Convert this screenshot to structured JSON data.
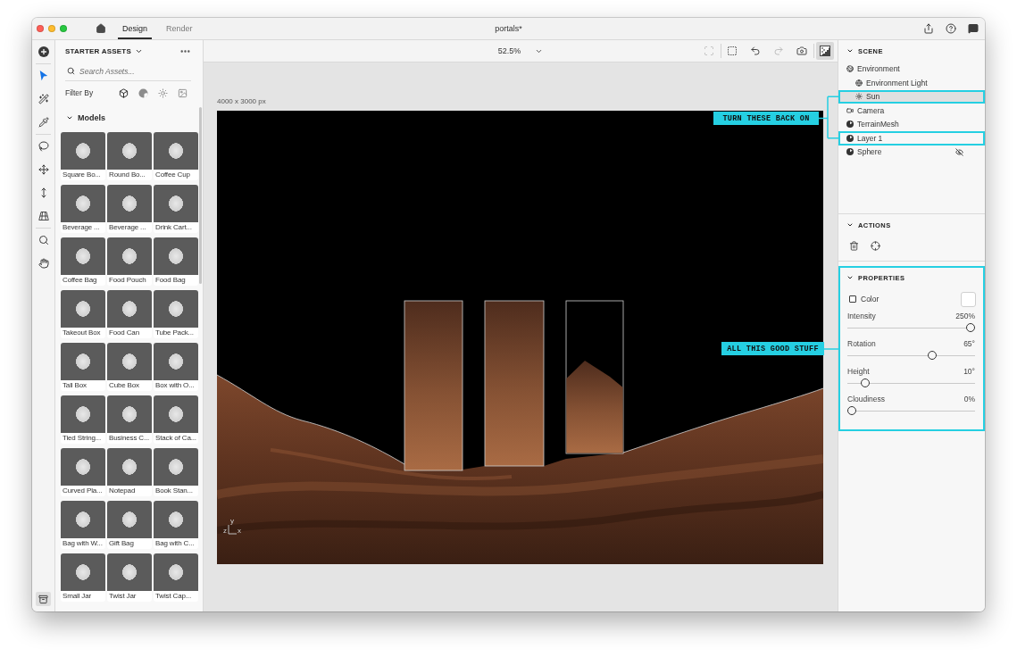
{
  "window": {
    "title": "portals*",
    "tabs": [
      {
        "label": "Design",
        "selected": true
      },
      {
        "label": "Render",
        "selected": false
      }
    ]
  },
  "toolbar": {
    "groups": [
      [
        {
          "kind": "add",
          "selected": false
        }
      ],
      [
        {
          "kind": "select",
          "selected": true
        },
        {
          "kind": "wand",
          "selected": false
        },
        {
          "kind": "eyedropper",
          "selected": false
        }
      ],
      [
        {
          "kind": "lasso",
          "selected": false
        },
        {
          "kind": "move",
          "selected": false
        },
        {
          "kind": "resize",
          "selected": false
        },
        {
          "kind": "perspective",
          "selected": false
        }
      ],
      [
        {
          "kind": "zoom",
          "selected": false
        },
        {
          "kind": "hand",
          "selected": false
        }
      ]
    ]
  },
  "assets": {
    "title": "STARTER ASSETS",
    "search": {
      "placeholder": "Search Assets..."
    },
    "filter_label": "Filter By",
    "filters": [
      {
        "kind": "model",
        "selected": true
      },
      {
        "kind": "material",
        "selected": false
      },
      {
        "kind": "light",
        "selected": false
      },
      {
        "kind": "image",
        "selected": false
      }
    ],
    "section": {
      "title": "Models",
      "expanded": true,
      "items": [
        "Square Bo...",
        "Round Bo...",
        "Coffee Cup",
        "Beverage ...",
        "Beverage ...",
        "Drink Cart...",
        "Coffee Bag",
        "Food Pouch",
        "Food Bag",
        "Takeout Box",
        "Food Can",
        "Tube Pack...",
        "Tall Box",
        "Cube Box",
        "Box with O...",
        "Tied String...",
        "Business C...",
        "Stack of Ca...",
        "Curved Pla...",
        "Notepad",
        "Book Stan...",
        "Bag with W...",
        "Gift Bag",
        "Bag with C...",
        "Small Jar",
        "Twist Jar",
        "Twist Cap..."
      ]
    }
  },
  "canvas": {
    "zoom": "52.5%",
    "tool_groups": [
      [
        {
          "kind": "frame",
          "disabled": true,
          "selected": false
        }
      ],
      [
        {
          "kind": "camera_frame",
          "disabled": false,
          "selected": false
        },
        {
          "kind": "camera_back",
          "disabled": false,
          "selected": false
        },
        {
          "kind": "camera_forward",
          "disabled": true,
          "selected": false
        },
        {
          "kind": "camera_add",
          "disabled": false,
          "selected": false
        }
      ],
      [
        {
          "kind": "preview",
          "disabled": false,
          "selected": true
        }
      ]
    ],
    "size_label": "4000 x 3000 px",
    "axis_labels": [
      "y",
      "z",
      "x"
    ]
  },
  "scene": {
    "title": "SCENE",
    "expanded": true,
    "items": [
      {
        "kind": "environment",
        "label": "Environment",
        "selected": false,
        "annotated": false,
        "hidden": false,
        "children": [
          {
            "kind": "globe",
            "label": "Environment Light",
            "selected": false,
            "annotated": false,
            "hidden": false
          },
          {
            "kind": "sun",
            "label": "Sun",
            "selected": true,
            "annotated": true,
            "hidden": false
          }
        ]
      },
      {
        "kind": "camera",
        "label": "Camera",
        "selected": false,
        "annotated": false,
        "hidden": false
      },
      {
        "kind": "model",
        "label": "TerrainMesh",
        "selected": false,
        "annotated": false,
        "hidden": false
      },
      {
        "kind": "model",
        "label": "Layer 1",
        "selected": false,
        "annotated": true,
        "hidden": false
      },
      {
        "kind": "model",
        "label": "Sphere",
        "selected": false,
        "annotated": false,
        "hidden": true
      }
    ]
  },
  "actions": {
    "title": "ACTIONS",
    "expanded": true,
    "buttons": [
      {
        "kind": "delete"
      },
      {
        "kind": "target"
      }
    ]
  },
  "properties": {
    "title": "PROPERTIES",
    "expanded": true,
    "annotated": true,
    "items": [
      {
        "kind": "color",
        "label": "Color",
        "checked": false,
        "color": "#ffffff"
      },
      {
        "kind": "slider",
        "label": "Intensity",
        "reading": "250%",
        "level": 1
      },
      {
        "kind": "slider",
        "label": "Rotation",
        "reading": "65°",
        "level": 0.68
      },
      {
        "kind": "slider",
        "label": "Height",
        "reading": "10°",
        "level": 0.11
      },
      {
        "kind": "slider",
        "label": "Cloudiness",
        "reading": "0%",
        "level": 0
      }
    ]
  },
  "annotations": [
    {
      "text": "TURN THESE BACK ON"
    },
    {
      "text": "ALL THIS GOOD STUFF"
    }
  ]
}
